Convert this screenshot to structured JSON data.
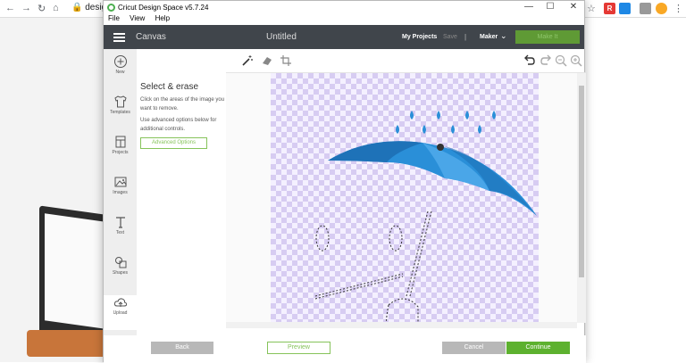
{
  "browser": {
    "url": "design",
    "nav": {
      "back": "←",
      "forward": "→",
      "reload": "↻",
      "home": "⌂"
    },
    "star": "☆",
    "menu": "⋮",
    "ext_colors": [
      "#e53935",
      "#1e88e5",
      "#f9a825"
    ]
  },
  "window": {
    "title": "Cricut Design Space  v5.7.24",
    "controls": {
      "minimize": "—",
      "maximize": "☐",
      "close": "✕"
    },
    "menu": [
      "File",
      "View",
      "Help"
    ]
  },
  "header": {
    "canvas": "Canvas",
    "document_title": "Untitled",
    "my_projects": "My Projects",
    "save": "Save",
    "separator": "|",
    "machine": "Maker",
    "make_it": "Make It"
  },
  "sidebar": {
    "items": [
      {
        "label": "New",
        "icon": "plus-circle-icon"
      },
      {
        "label": "Templates",
        "icon": "tshirt-icon"
      },
      {
        "label": "Projects",
        "icon": "projects-grid-icon"
      },
      {
        "label": "Images",
        "icon": "image-icon"
      },
      {
        "label": "Text",
        "icon": "text-t-icon"
      },
      {
        "label": "Shapes",
        "icon": "shapes-icon"
      },
      {
        "label": "Upload",
        "icon": "cloud-upload-icon"
      }
    ]
  },
  "panel": {
    "heading": "Select & erase",
    "instructions": "Click on the areas of the image you want to remove.",
    "advanced_hint": "Use advanced options below for additional controls.",
    "advanced_button": "Advanced Options"
  },
  "toolbar": {
    "tools": [
      "magic-wand-icon",
      "eraser-icon",
      "crop-icon"
    ],
    "actions": [
      "undo-icon",
      "redo-icon",
      "zoom-out-icon",
      "zoom-in-icon"
    ]
  },
  "footer": {
    "back": "Back",
    "preview": "Preview",
    "cancel": "Cancel",
    "continue": "Continue"
  },
  "colors": {
    "header": "#40454b",
    "accent_green": "#5db12f",
    "umbrella_blue": "#2a8fd8"
  }
}
